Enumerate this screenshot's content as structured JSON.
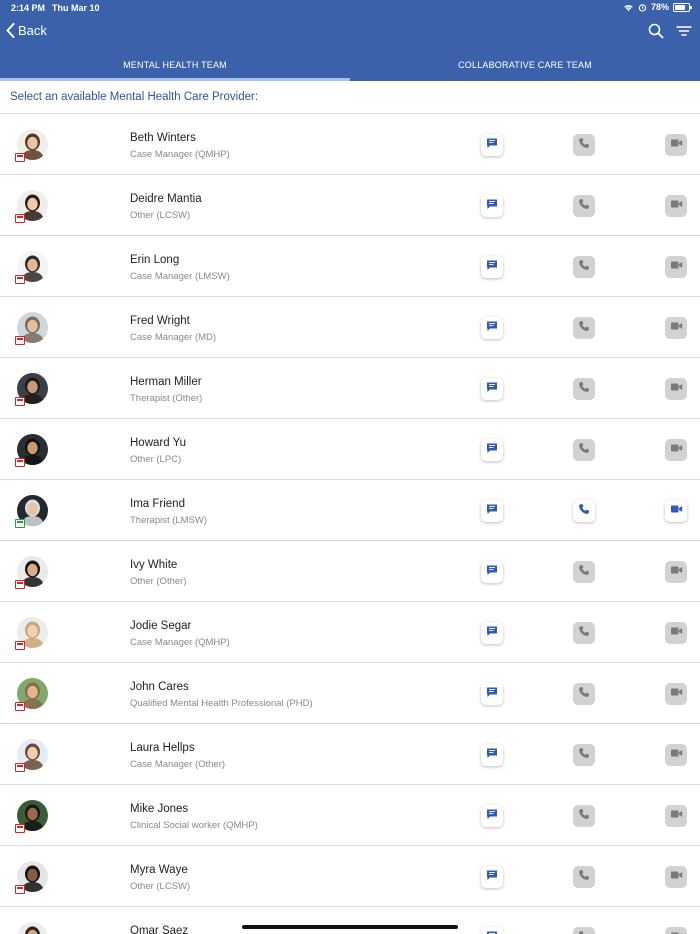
{
  "status": {
    "time": "2:14 PM",
    "date": "Thu Mar 10",
    "battery": "78%",
    "battery_level": 0.78
  },
  "nav": {
    "back_label": "Back",
    "search_icon": "search-icon",
    "filter_icon": "filter-icon"
  },
  "tabs": [
    {
      "label": "MENTAL HEALTH TEAM",
      "active": true
    },
    {
      "label": "COLLABORATIVE CARE TEAM",
      "active": false
    }
  ],
  "prompt": "Select an available Mental Health Care Provider:",
  "colors": {
    "primary": "#3b61ab",
    "icon_active": "#2f5bb5",
    "icon_disabled": "#7a7a7a",
    "unavailable": "#dd2222",
    "available": "#2a9d3a"
  },
  "providers": [
    {
      "name": "Beth Winters",
      "role": "Case Manager (QMHP)",
      "available": false,
      "skin": "#e7c3a3",
      "hair": "#5a3522",
      "bg": "#f2efe9"
    },
    {
      "name": "Deidre Mantia",
      "role": "Other (LCSW)",
      "available": false,
      "skin": "#edc9ae",
      "hair": "#2b1a12",
      "bg": "#eeeeee"
    },
    {
      "name": "Erin Long",
      "role": "Case Manager (LMSW)",
      "available": false,
      "skin": "#e0b896",
      "hair": "#2a2a2a",
      "bg": "#f4f4f4"
    },
    {
      "name": "Fred Wright",
      "role": "Case Manager (MD)",
      "available": false,
      "skin": "#e3bd9c",
      "hair": "#7a6a5a",
      "bg": "#cfd6dc"
    },
    {
      "name": "Herman Miller",
      "role": "Therapist (Other)",
      "available": false,
      "skin": "#c99a78",
      "hair": "#1f1a16",
      "bg": "#3a3f48"
    },
    {
      "name": "Howard Yu",
      "role": "Other (LPC)",
      "available": false,
      "skin": "#c79a72",
      "hair": "#111111",
      "bg": "#2b2e33"
    },
    {
      "name": "Ima Friend",
      "role": "Therapist (LMSW)",
      "available": true,
      "skin": "#e8c2a2",
      "hair": "#dcdcdc",
      "bg": "#25282c"
    },
    {
      "name": "Ivy White",
      "role": "Other (Other)",
      "available": false,
      "skin": "#d8ad8a",
      "hair": "#141414",
      "bg": "#eaeaea"
    },
    {
      "name": "Jodie Segar",
      "role": "Case Manager (QMHP)",
      "available": false,
      "skin": "#f0d0b5",
      "hair": "#c9a477",
      "bg": "#ececec"
    },
    {
      "name": "John Cares",
      "role": "Qualified Mental Health Professional (PHD)",
      "available": false,
      "skin": "#e2b58f",
      "hair": "#8a6a4a",
      "bg": "#7fa86a"
    },
    {
      "name": "Laura Hellps",
      "role": "Case Manager (Other)",
      "available": false,
      "skin": "#f0cdb2",
      "hair": "#6a4a32",
      "bg": "#e4ecf4"
    },
    {
      "name": "Mike Jones",
      "role": "Clinical Social worker (QMHP)",
      "available": false,
      "skin": "#9a6a48",
      "hair": "#151515",
      "bg": "#3d5a38"
    },
    {
      "name": "Myra Waye",
      "role": "Other (LCSW)",
      "available": false,
      "skin": "#8a5a3e",
      "hair": "#101010",
      "bg": "#e6e6e6"
    },
    {
      "name": "Omar Saez",
      "role": "",
      "available": false,
      "skin": "#d9a987",
      "hair": "#2a2018",
      "bg": "#eeeeee"
    }
  ]
}
